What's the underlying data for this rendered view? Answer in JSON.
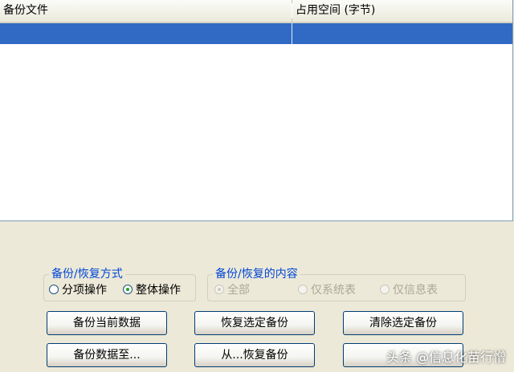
{
  "listview": {
    "columns": [
      "备份文件",
      "占用空间 (字节)"
    ]
  },
  "backup_mode": {
    "title": "备份/恢复方式",
    "options": [
      {
        "label": "分项操作",
        "checked": false
      },
      {
        "label": "整体操作",
        "checked": true
      }
    ]
  },
  "backup_content": {
    "title": "备份/恢复的内容",
    "options": [
      {
        "label": "全部",
        "checked": true,
        "disabled": true
      },
      {
        "label": "仅系统表",
        "checked": false,
        "disabled": true
      },
      {
        "label": "仅信息表",
        "checked": false,
        "disabled": true
      }
    ]
  },
  "buttons": {
    "backup_current": "备份当前数据",
    "restore_selected": "恢复选定备份",
    "clear_selected": "清除选定备份",
    "backup_to": "备份数据至...",
    "restore_from": "从...恢复备份",
    "extra": ""
  },
  "watermark": "头条 @信息化苗行憎",
  "colors": {
    "selection": "#316ac5",
    "groupbox_title": "#0046d5",
    "background": "#ece9d8"
  }
}
